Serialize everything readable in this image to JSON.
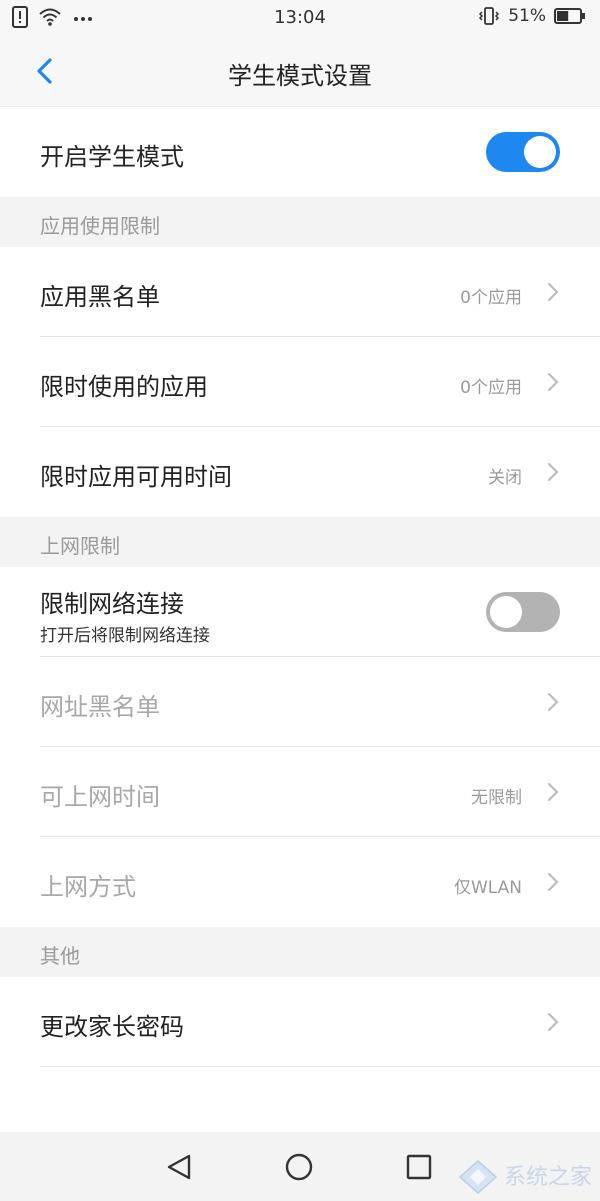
{
  "status_bar": {
    "time": "13:04",
    "battery_percent": "51%",
    "battery_level": 0.51,
    "icons": [
      "alert-icon",
      "wifi-icon",
      "more-dots-icon",
      "vibrate-icon",
      "battery-icon"
    ]
  },
  "header": {
    "title": "学生模式设置"
  },
  "student_mode": {
    "label": "开启学生模式",
    "enabled": true
  },
  "sections": {
    "app_limits": {
      "header": "应用使用限制",
      "blacklist_label": "应用黑名单",
      "blacklist_value": "0个应用",
      "timed_apps_label": "限时使用的应用",
      "timed_apps_value": "0个应用",
      "available_time_label": "限时应用可用时间",
      "available_time_value": "关闭"
    },
    "internet_limits": {
      "header": "上网限制",
      "restrict_label": "限制网络连接",
      "restrict_subtitle": "打开后将限制网络连接",
      "restrict_enabled": false,
      "url_blacklist_label": "网址黑名单",
      "online_time_label": "可上网时间",
      "online_time_value": "无限制",
      "method_label": "上网方式",
      "method_value": "仅WLAN"
    },
    "other": {
      "header": "其他",
      "change_password_label": "更改家长密码"
    }
  },
  "watermark": {
    "text": "系统之家"
  },
  "colors": {
    "accent": "#1e87f0",
    "toggle_off": "#b3b3b3",
    "section_bg": "#f3f3f3"
  }
}
